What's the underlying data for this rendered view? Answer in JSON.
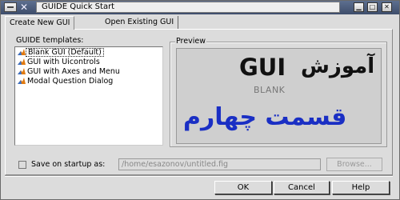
{
  "window": {
    "title": "GUIDE Quick Start"
  },
  "tabs": [
    {
      "label": "Create New GUI",
      "active": true
    },
    {
      "label": "Open Existing GUI",
      "active": false
    }
  ],
  "templates": {
    "label": "GUIDE templates:",
    "items": [
      {
        "label": "Blank GUI (Default)",
        "selected": true
      },
      {
        "label": "GUI with Uicontrols",
        "selected": false
      },
      {
        "label": "GUI with Axes and Menu",
        "selected": false
      },
      {
        "label": "Modal Question Dialog",
        "selected": false
      }
    ]
  },
  "preview": {
    "label": "Preview",
    "gui_text": "GUI",
    "overlay_text_1": "آموزش",
    "blank_text": "BLANK",
    "overlay_text_2": "قسمت چهارم"
  },
  "save": {
    "label": "Save on startup as:",
    "checked": false,
    "path": "/home/esazonov/untitled.fig",
    "browse_label": "Browse..."
  },
  "buttons": {
    "ok": "OK",
    "cancel": "Cancel",
    "help": "Help"
  },
  "colors": {
    "overlay_blue": "#1a2fc4",
    "titlebar": "#4a5a7a"
  }
}
